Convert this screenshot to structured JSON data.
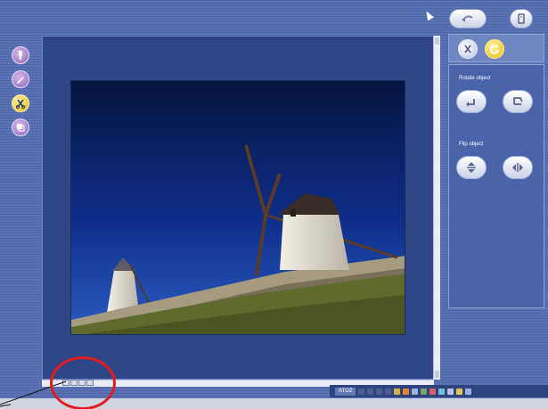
{
  "header": {
    "undo_icon": "undo-arrow-icon",
    "menu_icon": "menu-icon",
    "cursor_icon": "mouse-pointer-icon"
  },
  "tools": [
    {
      "name": "tool-paint",
      "icon": "paint-icon",
      "active": false
    },
    {
      "name": "tool-pencil",
      "icon": "pencil-icon",
      "active": false
    },
    {
      "name": "tool-edit",
      "icon": "scissors-icon",
      "active": true
    },
    {
      "name": "tool-layers",
      "icon": "layers-icon",
      "active": false
    }
  ],
  "mode_bar": {
    "crop_icon": "scissors-icon",
    "rotate_icon": "rotate-icon"
  },
  "panel": {
    "rotate_label": "Rotate object",
    "flip_label": "Flip object",
    "rotate_left_icon": "rotate-left-icon",
    "rotate_right_icon": "rotate-right-icon",
    "flip_vertical_icon": "flip-vertical-icon",
    "flip_horizontal_icon": "flip-horizontal-icon"
  },
  "canvas": {
    "image_subject": "windmills-on-hill-photo"
  },
  "status": {
    "label": "ATOZ"
  },
  "annotation": {
    "color": "#e51c1c",
    "shape": "circle-with-pointer-line"
  },
  "colors": {
    "background": "#5b73b4",
    "canvas": "#2f4586",
    "accent": "#f0b800"
  }
}
